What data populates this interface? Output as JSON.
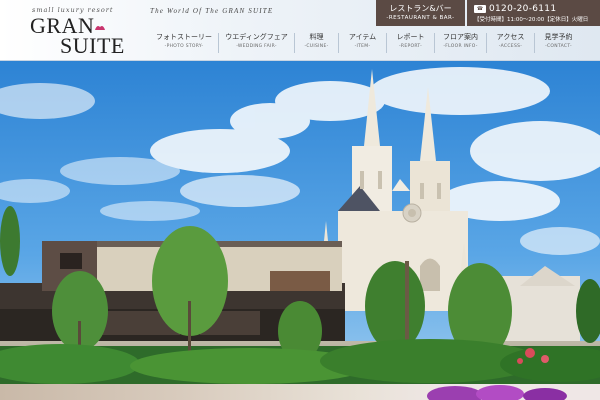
{
  "brand": {
    "tagline": "small luxury resort",
    "name_line1": "GRAN",
    "name_line2": "SUITE"
  },
  "header": {
    "world_text": "The World Of The GRAN SUITE"
  },
  "restaurant": {
    "title": "レストラン&バー",
    "subtitle": "-RESTAURANT & BAR-"
  },
  "contact": {
    "tel_icon": "phone-icon",
    "phone": "0120-20-6111",
    "hours": "【受付時間】11:00～20:00【定休日】火曜日"
  },
  "nav": {
    "items": [
      {
        "ja": "フォトストーリー",
        "en": "-PHOTO STORY-"
      },
      {
        "ja": "ウエディングフェア",
        "en": "-WEDDING FAIR-"
      },
      {
        "ja": "料理",
        "en": "-CUISINE-"
      },
      {
        "ja": "アイテム",
        "en": "-ITEM-"
      },
      {
        "ja": "レポート",
        "en": "-REPORT-"
      },
      {
        "ja": "フロア案内",
        "en": "-FLOOR INFO-"
      },
      {
        "ja": "アクセス",
        "en": "-ACCESS-"
      },
      {
        "ja": "見学予約",
        "en": "-CONTACT-"
      }
    ]
  },
  "colors": {
    "header_brown": "#5b4a44",
    "sky_top": "#2f86d6",
    "sky_bottom": "#8fc4ee",
    "chapel": "#f1ece2"
  }
}
